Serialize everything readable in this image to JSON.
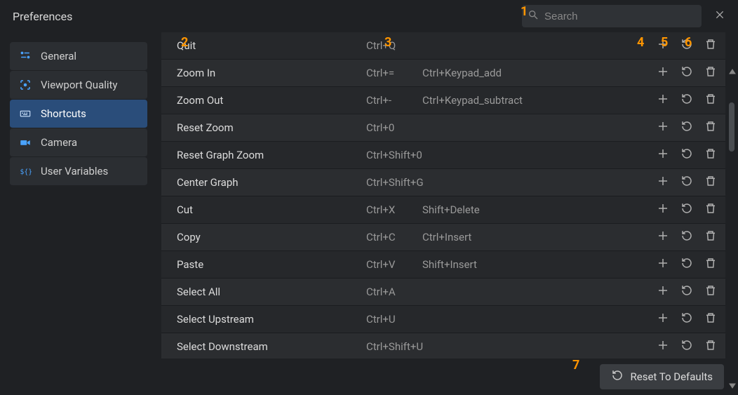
{
  "header": {
    "title": "Preferences",
    "search_placeholder": "Search"
  },
  "sidebar": {
    "items": [
      {
        "label": "General",
        "icon": "sliders",
        "active": false
      },
      {
        "label": "Viewport Quality",
        "icon": "viewport",
        "active": false
      },
      {
        "label": "Shortcuts",
        "icon": "keyboard",
        "active": true
      },
      {
        "label": "Camera",
        "icon": "camera",
        "active": false
      },
      {
        "label": "User Variables",
        "icon": "vars",
        "active": false
      }
    ]
  },
  "shortcuts": [
    {
      "name": "Quit",
      "key1": "Ctrl+Q",
      "key2": ""
    },
    {
      "name": "Zoom In",
      "key1": "Ctrl+=",
      "key2": "Ctrl+Keypad_add"
    },
    {
      "name": "Zoom Out",
      "key1": "Ctrl+-",
      "key2": "Ctrl+Keypad_subtract"
    },
    {
      "name": "Reset Zoom",
      "key1": "Ctrl+0",
      "key2": ""
    },
    {
      "name": "Reset Graph Zoom",
      "key1": "Ctrl+Shift+0",
      "key2": ""
    },
    {
      "name": "Center Graph",
      "key1": "Ctrl+Shift+G",
      "key2": ""
    },
    {
      "name": "Cut",
      "key1": "Ctrl+X",
      "key2": "Shift+Delete"
    },
    {
      "name": "Copy",
      "key1": "Ctrl+C",
      "key2": "Ctrl+Insert"
    },
    {
      "name": "Paste",
      "key1": "Ctrl+V",
      "key2": "Shift+Insert"
    },
    {
      "name": "Select All",
      "key1": "Ctrl+A",
      "key2": ""
    },
    {
      "name": "Select Upstream",
      "key1": "Ctrl+U",
      "key2": ""
    },
    {
      "name": "Select Downstream",
      "key1": "Ctrl+Shift+U",
      "key2": ""
    }
  ],
  "footer": {
    "reset_label": "Reset To Defaults"
  },
  "annotations": {
    "n1": "1",
    "n2": "2",
    "n3": "3",
    "n4": "4",
    "n5": "5",
    "n6": "6",
    "n7": "7"
  }
}
